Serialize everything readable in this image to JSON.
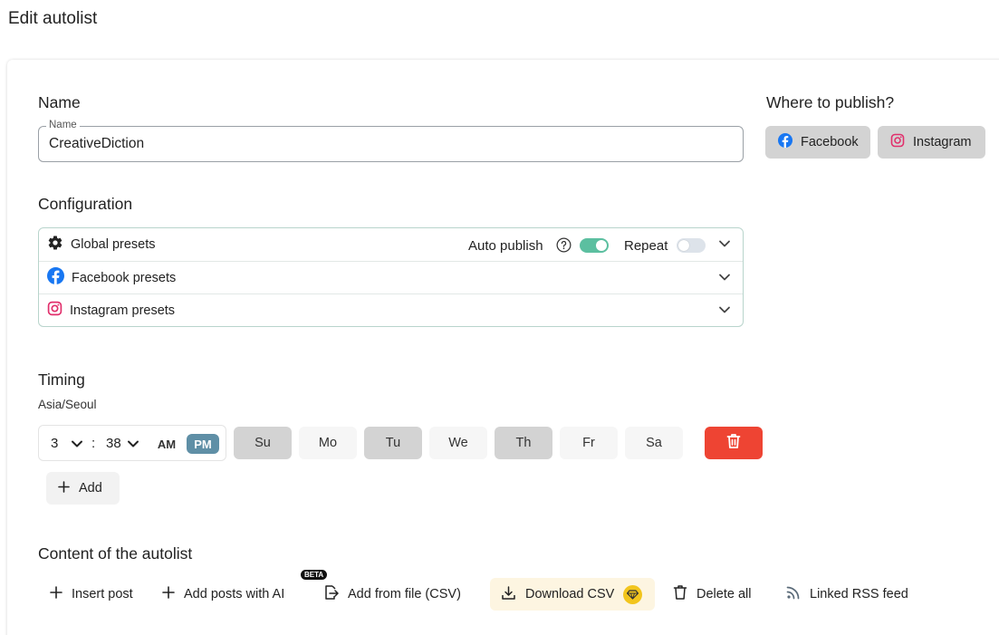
{
  "page": {
    "title": "Edit autolist"
  },
  "name_section": {
    "title": "Name",
    "field_legend": "Name",
    "field_value": "CreativeDiction"
  },
  "publish": {
    "title": "Where to publish?",
    "facebook_label": "Facebook",
    "instagram_label": "Instagram"
  },
  "configuration": {
    "title": "Configuration",
    "global_label": "Global presets",
    "auto_publish_label": "Auto publish",
    "auto_publish_on": true,
    "repeat_label": "Repeat",
    "repeat_on": false,
    "facebook_label": "Facebook presets",
    "instagram_label": "Instagram presets"
  },
  "timing": {
    "title": "Timing",
    "timezone": "Asia/Seoul",
    "hour": "3",
    "minute": "38",
    "am_label": "AM",
    "pm_label": "PM",
    "selected_period": "PM",
    "days": [
      "Su",
      "Mo",
      "Tu",
      "We",
      "Th",
      "Fr",
      "Sa"
    ],
    "selected_days": [
      "Su",
      "Tu",
      "Th"
    ],
    "add_label": "Add"
  },
  "content": {
    "title": "Content of the autolist",
    "insert_post": "Insert post",
    "add_ai": "Add posts with AI",
    "beta_badge": "BETA",
    "add_csv": "Add from file (CSV)",
    "download_csv": "Download CSV",
    "delete_all": "Delete all",
    "rss": "Linked RSS feed"
  },
  "colors": {
    "facebook": "#1877f2",
    "instagram": "#e1306c",
    "toggle_on": "#5cbfa0",
    "pm_active": "#5f8fa6",
    "delete_red": "#ee4433",
    "premium_gold": "#f2c51d"
  }
}
